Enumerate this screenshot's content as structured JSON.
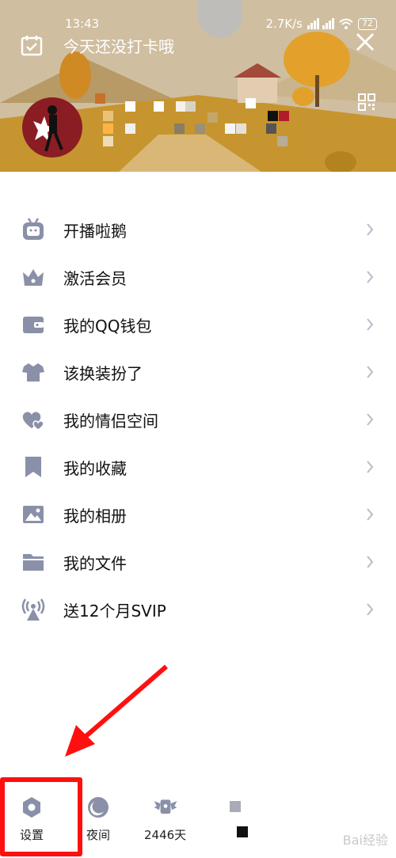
{
  "status_bar": {
    "time": "13:43",
    "speed": "2.7K/s",
    "battery": "72"
  },
  "header": {
    "checkin_text": "今天还没打卡哦"
  },
  "menu": {
    "items": [
      {
        "label": "开播啦鹅",
        "icon": "tv-face-icon"
      },
      {
        "label": "激活会员",
        "icon": "crown-icon"
      },
      {
        "label": "我的QQ钱包",
        "icon": "wallet-icon"
      },
      {
        "label": "该换装扮了",
        "icon": "tshirt-icon"
      },
      {
        "label": "我的情侣空间",
        "icon": "hearts-icon"
      },
      {
        "label": "我的收藏",
        "icon": "bookmark-icon"
      },
      {
        "label": "我的相册",
        "icon": "photo-icon"
      },
      {
        "label": "我的文件",
        "icon": "folder-icon"
      },
      {
        "label": "送12个月SVIP",
        "icon": "broadcast-icon"
      }
    ]
  },
  "bottom": {
    "settings_label": "设置",
    "night_label": "夜间",
    "days_label": "2446天"
  },
  "colors": {
    "icon_gray": "#8a90a8",
    "highlight_red": "#ff1010",
    "avatar_bg": "#8a1d23"
  },
  "watermark": "Bai经验"
}
